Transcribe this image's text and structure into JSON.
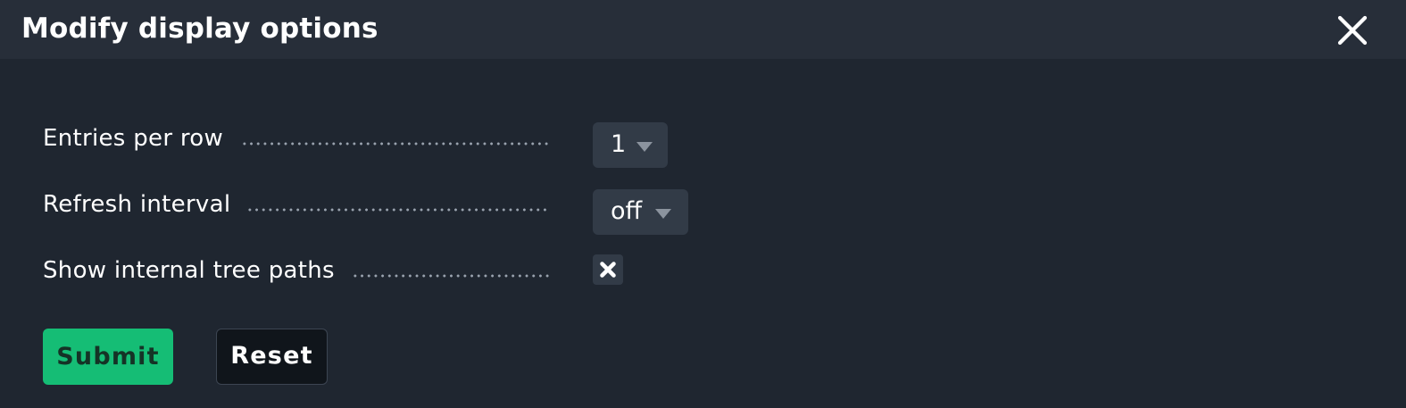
{
  "dialog": {
    "title": "Modify display options",
    "close_icon": "close-icon"
  },
  "options": [
    {
      "label": "Entries per row",
      "type": "select",
      "value": "1"
    },
    {
      "label": "Refresh interval",
      "type": "select",
      "value": "off"
    },
    {
      "label": "Show internal tree paths",
      "type": "checkbox",
      "checked": true,
      "mark_icon": "x-mark-icon"
    }
  ],
  "buttons": {
    "submit_label": "Submit",
    "reset_label": "Reset"
  },
  "colors": {
    "background": "#1f2630",
    "header_background": "#272e39",
    "control_background": "#323b47",
    "submit_green": "#15bd75",
    "reset_background": "#10151b"
  }
}
